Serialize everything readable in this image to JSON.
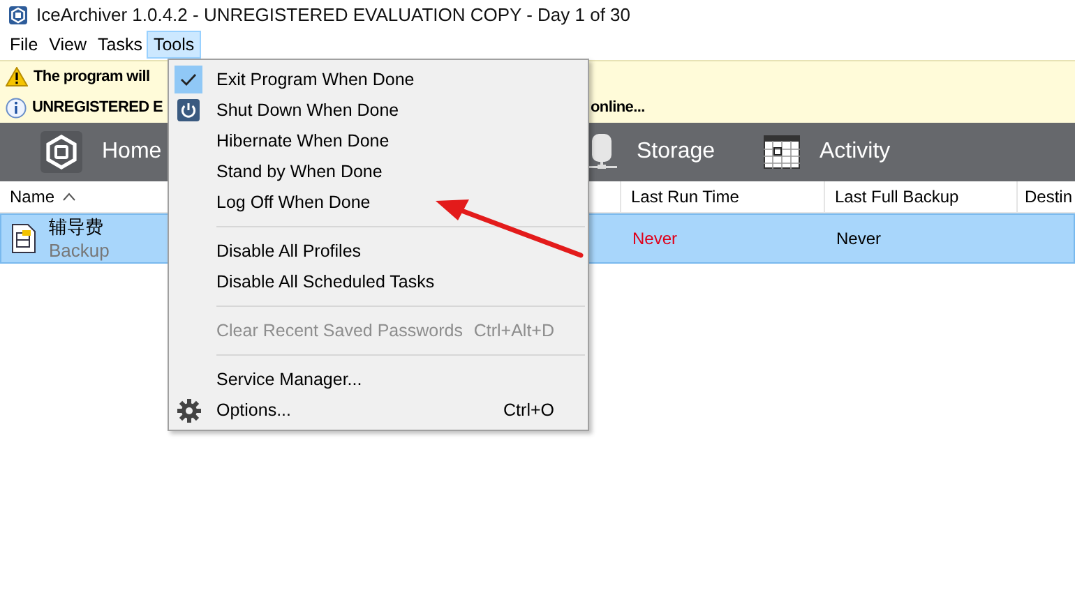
{
  "window": {
    "title": "IceArchiver 1.0.4.2 - UNREGISTERED EVALUATION COPY - Day 1 of 30"
  },
  "menubar": [
    {
      "label": "File",
      "selected": false
    },
    {
      "label": "View",
      "selected": false
    },
    {
      "label": "Tasks",
      "selected": false
    },
    {
      "label": "Tools",
      "selected": true
    }
  ],
  "banners": [
    {
      "kind": "warning",
      "text": "The program will"
    },
    {
      "kind": "info",
      "text": "UNREGISTERED E",
      "text_right": "online..."
    }
  ],
  "nav": [
    {
      "kind": "home",
      "label": "Home"
    },
    {
      "kind": "storage",
      "label": "Storage"
    },
    {
      "kind": "activity",
      "label": "Activity"
    }
  ],
  "table": {
    "columns": [
      {
        "label": "Name",
        "sorted": true
      },
      {
        "label": "Last Run Time",
        "sorted": false
      },
      {
        "label": "Last Full Backup",
        "sorted": false
      },
      {
        "label": "Destin"
      }
    ],
    "rows": [
      {
        "name": "辅导费",
        "type": "Backup",
        "last_run": "Never",
        "last_run_alert": true,
        "last_full": "Never",
        "selected": true
      }
    ]
  },
  "tools_menu": [
    {
      "kind": "item",
      "label": "Exit Program When Done",
      "checked": true,
      "disabled": false
    },
    {
      "kind": "power",
      "label": "Shut Down When Done",
      "checked": false,
      "disabled": false
    },
    {
      "kind": "item",
      "label": "Hibernate When Done",
      "checked": false,
      "disabled": false
    },
    {
      "kind": "item",
      "label": "Stand by When Done",
      "checked": false,
      "disabled": false
    },
    {
      "kind": "item",
      "label": "Log Off When Done",
      "checked": false,
      "disabled": false
    },
    {
      "kind": "separator"
    },
    {
      "kind": "item",
      "label": "Disable All Profiles",
      "checked": false,
      "disabled": false
    },
    {
      "kind": "item",
      "label": "Disable All Scheduled Tasks",
      "checked": false,
      "disabled": false
    },
    {
      "kind": "separator"
    },
    {
      "kind": "item",
      "label": "Clear Recent Saved Passwords",
      "checked": false,
      "disabled": true,
      "shortcut": "Ctrl+Alt+D"
    },
    {
      "kind": "separator"
    },
    {
      "kind": "item",
      "label": "Service Manager...",
      "checked": false,
      "disabled": false
    },
    {
      "kind": "options",
      "label": "Options...",
      "checked": false,
      "disabled": false,
      "shortcut": "Ctrl+O"
    }
  ]
}
